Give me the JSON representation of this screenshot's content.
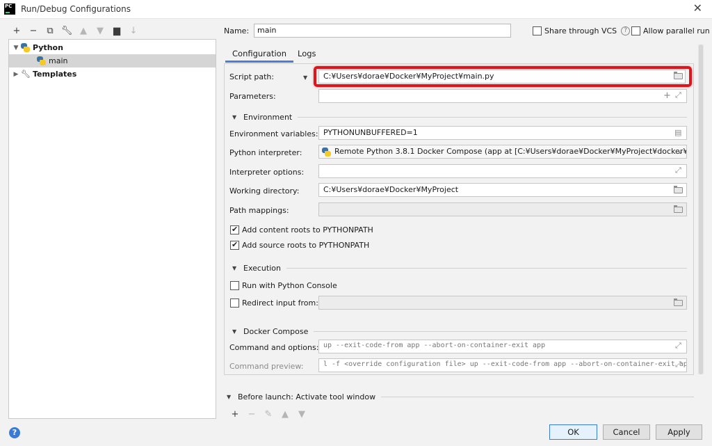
{
  "window": {
    "title": "Run/Debug Configurations",
    "app_icon_text": "PC"
  },
  "tree": {
    "python_label": "Python",
    "main_label": "main",
    "templates_label": "Templates"
  },
  "name": {
    "label": "Name:",
    "value": "main"
  },
  "options": {
    "share_vcs": "Share through VCS",
    "allow_parallel": "Allow parallel run"
  },
  "tabs": [
    "Configuration",
    "Logs"
  ],
  "script_path": {
    "label": "Script path:",
    "value": "C:¥Users¥dorae¥Docker¥MyProject¥main.py"
  },
  "parameters": {
    "label": "Parameters:",
    "value": ""
  },
  "environment": {
    "section": "Environment",
    "env_vars_label": "Environment variables:",
    "env_vars_value": "PYTHONUNBUFFERED=1",
    "interpreter_label": "Python interpreter:",
    "interpreter_value": "Remote Python 3.8.1 Docker Compose (app at [C:¥Users¥dorae¥Docker¥MyProject¥docker¥docker",
    "interp_options_label": "Interpreter options:",
    "interp_options_value": "",
    "working_dir_label": "Working directory:",
    "working_dir_value": "C:¥Users¥dorae¥Docker¥MyProject",
    "path_mappings_label": "Path mappings:",
    "path_mappings_value": "",
    "content_roots": "Add content roots to PYTHONPATH",
    "source_roots": "Add source roots to PYTHONPATH"
  },
  "execution": {
    "section": "Execution",
    "run_console": "Run with Python Console",
    "redirect_input": "Redirect input from:",
    "redirect_value": ""
  },
  "docker": {
    "section": "Docker Compose",
    "cmd_options_label": "Command and options:",
    "cmd_options_value": "up --exit-code-from app --abort-on-container-exit app",
    "cmd_preview_label": "Command preview:",
    "cmd_preview_value": "l -f <override configuration file> up --exit-code-from app --abort-on-container-exit app"
  },
  "before_launch": {
    "label": "Before launch: Activate tool window"
  },
  "buttons": {
    "ok": "OK",
    "cancel": "Cancel",
    "apply": "Apply"
  },
  "help": {
    "symbol": "?"
  },
  "colors": {
    "highlight": "#e0141a",
    "accent": "#4c7ed8",
    "selected_row": "#d5d5d5"
  }
}
